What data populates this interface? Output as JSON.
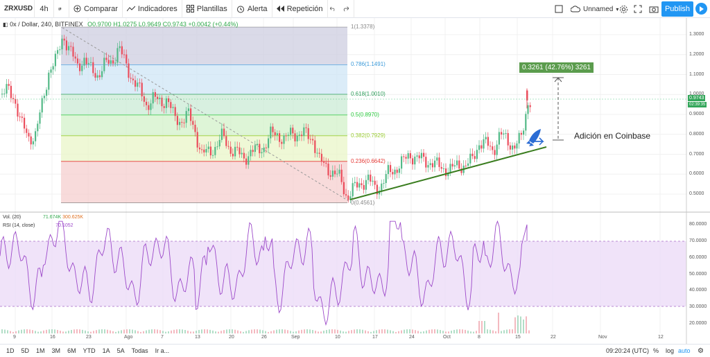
{
  "toolbar": {
    "symbol": "ZRXUSD",
    "interval": "4h",
    "compare": "Comparar",
    "indicators": "Indicadores",
    "templates": "Plantillas",
    "alert": "Alerta",
    "replay": "Repetición",
    "layout_name": "Unnamed",
    "publish": "Publish"
  },
  "legend": {
    "title": "0x / Dollar, 240, BITFINEX",
    "o": "O0.9700",
    "h": "H1.0275",
    "l": "L0.9649",
    "c": "C0.9743",
    "chg": "+0.0042 (+0.44%)",
    "vol_label": "Vol. (20)",
    "vol_v1": "71.674K",
    "vol_v2": "300.625K",
    "rsi_label": "RSI (14, close)",
    "rsi_value": "70.1052"
  },
  "fib": {
    "levels": [
      {
        "label": "1(1.3378)",
        "value": 1.3378,
        "color": "#8a8a8a",
        "fill": "#d9d9d9"
      },
      {
        "label": "0.786(1.1491)",
        "value": 1.1491,
        "color": "#3a9ad9",
        "fill": "#cfe6f5"
      },
      {
        "label": "0.618(1.0010)",
        "value": 1.001,
        "color": "#2e9e5b",
        "fill": "#cbebd5"
      },
      {
        "label": "0.5(0.8970)",
        "value": 0.897,
        "color": "#2ecc40",
        "fill": "#d3f2c9"
      },
      {
        "label": "0.382(0.7929)",
        "value": 0.7929,
        "color": "#9acd32",
        "fill": "#e9f5c8"
      },
      {
        "label": "0.236(0.6642)",
        "value": 0.6642,
        "color": "#e53935",
        "fill": "#f5cfcf"
      },
      {
        "label": "0(0.4561)",
        "value": 0.4561,
        "color": "#888",
        "fill": ""
      }
    ]
  },
  "annotation": {
    "measure": "0.3261 (42.76%) 3261",
    "text": "Adición en Coinbase"
  },
  "price_axis": {
    "ticks": [
      "1.3000",
      "1.2000",
      "1.1000",
      "1.0000",
      "0.9000",
      "0.8000",
      "0.7000",
      "0.6000",
      "0.5000"
    ],
    "current": "0.9743",
    "timer": "02:39:35"
  },
  "rsi_axis": {
    "ticks": [
      "80.0000",
      "70.0000",
      "60.0000",
      "50.0000",
      "40.0000",
      "30.0000",
      "20.0000"
    ]
  },
  "dates": [
    "9",
    "16",
    "23",
    "Ago",
    "7",
    "13",
    "20",
    "26",
    "Sep",
    "10",
    "17",
    "24",
    "Oct",
    "8",
    "15",
    "22",
    "Nov",
    "12"
  ],
  "ranges": [
    "1D",
    "5D",
    "1M",
    "3M",
    "6M",
    "YTD",
    "1A",
    "5A",
    "Todas",
    "Ir a..."
  ],
  "status": {
    "time": "09:20:24 (UTC)",
    "percent": "%",
    "log": "log",
    "auto": "auto"
  },
  "chart_data": {
    "type": "candlestick",
    "symbol": "ZRXUSD",
    "exchange": "BITFINEX",
    "interval": "240",
    "ylim": [
      0.44,
      1.38
    ],
    "rsi_ylim": [
      17,
      86
    ]
  }
}
